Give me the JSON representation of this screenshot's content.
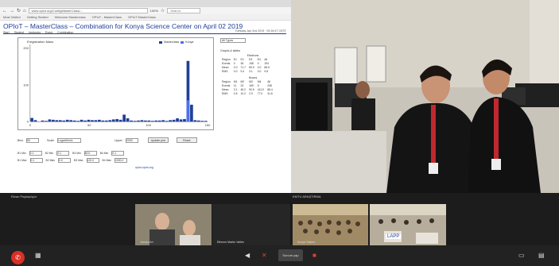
{
  "browser": {
    "url": "www.oplot.org/ConfigMasterClass/...",
    "zoom": "100%",
    "search_placeholder": "Search",
    "bookmarks": [
      "Most Visited",
      "Getting Started",
      "Welcome Masterclass",
      "OPIoT - MasterClass",
      "OPIoT MasterClass"
    ]
  },
  "page": {
    "title": "OPIoT – MasterClass – Combination for Konya Science Center on April 02 2019",
    "menu": [
      "Start",
      "Student",
      "Instructor",
      "Event",
      "Combination"
    ],
    "date": "Tuesday, Apr 2nd 2019 · 09:18:47 CEST",
    "chart_title": "Eregistration Mass",
    "legend": [
      "Masterclass",
      "Konya"
    ],
    "footer_link": "opiot.opiot.org",
    "right_select": "All Types",
    "right_header": "Graphs & tables",
    "table1_title": "Electrons",
    "table2_title": "Muons",
    "controls": {
      "bins_label": "Bins",
      "bins_value": "50",
      "scale_label": "Scale",
      "scale_value": "Logarithmic",
      "upper_label": "Upper",
      "upper_value": "2000",
      "update_btn": "Update plot",
      "reset_btn": "Reset"
    },
    "inputs": [
      {
        "label": "B1 Min",
        "value": "0.1"
      },
      {
        "label": "B2 Min",
        "value": "0.1"
      },
      {
        "label": "B3 Min",
        "value": "60.0"
      },
      {
        "label": "B4 Min",
        "value": "0.1"
      }
    ],
    "inputs2": [
      {
        "label": "B1 Max",
        "value": "0.1"
      },
      {
        "label": "B2 Max",
        "value": "0.0"
      },
      {
        "label": "B3 Max",
        "value": "120.0"
      },
      {
        "label": "B4 Max",
        "value": "1000.0"
      }
    ]
  },
  "meeting": {
    "share_label": "Ekran Paylaşılıyor",
    "main_label": "KMTU ARAŞTIRMA",
    "participants": [
      "Janusz Ari",
      "Etienne Martin Vallée",
      "Konya Salonu",
      "LAPP"
    ],
    "present_label": "Sunum yap",
    "colors": {
      "hangup": "#d93025",
      "accent_blue": "#1f3f99",
      "bar_blue": "#1f3fd6"
    }
  },
  "chart_data": {
    "type": "bar",
    "title": "Eregistration Mass",
    "legend": [
      "Masterclass",
      "Konya"
    ],
    "x": [
      0,
      3,
      6,
      9,
      12,
      15,
      18,
      21,
      24,
      27,
      30,
      33,
      36,
      39,
      42,
      45,
      48,
      51,
      54,
      57,
      60,
      63,
      66,
      69,
      72,
      75,
      78,
      81,
      84,
      87,
      90,
      93,
      96,
      99,
      102,
      105,
      108,
      111,
      114,
      117,
      120,
      123,
      126,
      129,
      132,
      135,
      138,
      141,
      144,
      147
    ],
    "series": [
      {
        "name": "Masterclass",
        "values": [
          10,
          4,
          0,
          3,
          2,
          6,
          5,
          4,
          4,
          3,
          5,
          4,
          3,
          2,
          5,
          3,
          5,
          4,
          4,
          5,
          3,
          3,
          4,
          6,
          7,
          5,
          19,
          9,
          3,
          2,
          3,
          4,
          3,
          3,
          2,
          3,
          3,
          4,
          2,
          4,
          5,
          9,
          6,
          7,
          165,
          46,
          4,
          3,
          2,
          2
        ]
      },
      {
        "name": "Konya",
        "values": [
          0,
          0,
          0,
          0,
          0,
          0,
          0,
          0,
          0,
          0,
          0,
          0,
          0,
          0,
          0,
          0,
          0,
          0,
          0,
          0,
          0,
          0,
          0,
          0,
          0,
          0,
          0,
          0,
          0,
          0,
          0,
          0,
          0,
          0,
          0,
          0,
          0,
          0,
          0,
          0,
          0,
          0,
          0,
          0,
          58,
          0,
          0,
          0,
          0,
          0
        ]
      }
    ],
    "x_ticks": [
      "0",
      "50",
      "100",
      "150"
    ],
    "y_ticks": [
      "0",
      "100",
      "200"
    ],
    "ylim": [
      0,
      210
    ]
  }
}
